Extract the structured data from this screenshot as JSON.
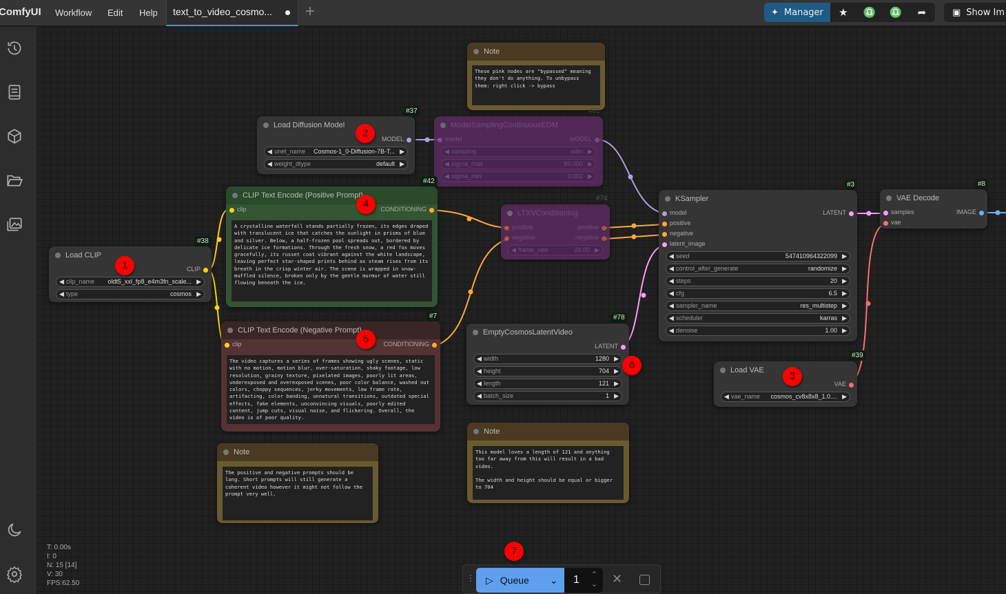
{
  "app": {
    "brand": "ComfyUI",
    "menu": [
      "Workflow",
      "Edit",
      "Help"
    ],
    "tab_title": "text_to_video_cosmo...",
    "manager_label": "Manager",
    "show_image_label": "Show Im"
  },
  "sidebar": [
    "history-icon",
    "book-icon",
    "cube-icon",
    "folder-open-icon",
    "images-icon",
    "moon-icon",
    "gear-icon"
  ],
  "stats": {
    "t": "T: 0.00s",
    "i": "I: 0",
    "n": "N: 15 [14]",
    "v": "V: 30",
    "fps": "FPS:62.50"
  },
  "queue": {
    "label": "Queue",
    "count": "1"
  },
  "nodes": {
    "note_top": {
      "title": "Note",
      "text": "These pink nodes are \"bypassed\" meaning\nthey don't do anything. To unbypass\nthem: right click -> bypass"
    },
    "load_diffusion": {
      "id": "#37",
      "title": "Load Diffusion Model",
      "output": "MODEL",
      "widgets": [
        {
          "name": "unet_name",
          "value": "Cosmos-1_0-Diffusion-7B-T..."
        },
        {
          "name": "weight_dtype",
          "value": "default"
        }
      ]
    },
    "model_sampling": {
      "id": "#61",
      "title": "ModelSamplingContinuousEDM",
      "input": "model",
      "output": "MODEL",
      "widgets": [
        {
          "name": "sampling",
          "value": "edm"
        },
        {
          "name": "sigma_max",
          "value": "80.000"
        },
        {
          "name": "sigma_min",
          "value": "0.002"
        }
      ]
    },
    "clip_pos": {
      "id": "#42",
      "title": "CLIP Text Encode (Positive Prompt)",
      "input": "clip",
      "output": "CONDITIONING",
      "text": "A crystalline waterfall stands partially frozen, its edges draped with translucent ice that catches the sunlight in prisms of blue and silver. Below, a half-frozen pool spreads out, bordered by delicate ice formations. Through the fresh snow, a red fox moves gracefully, its russet coat vibrant against the white landscape, leaving perfect star-shaped prints behind as steam rises from its breath in the crisp winter air. The scene is wrapped in snow-muffled silence, broken only by the gentle murmur of water still flowing beneath the ice."
    },
    "clip_neg": {
      "id": "#7",
      "title": "CLIP Text Encode (Negative Prompt)",
      "input": "clip",
      "output": "CONDITIONING",
      "text": "The video captures a series of frames showing ugly scenes, static with no motion, motion blur, over-saturation, shaky footage, low resolution, grainy texture, pixelated images, poorly lit areas, underexposed and overexposed scenes, poor color balance, washed out colors, choppy sequences, jerky movements, low frame rate, artifacting, color banding, unnatural transitions, outdated special effects, fake elements, unconvincing visuals, poorly edited content, jump cuts, visual noise, and flickering. Overall, the video is of poor quality."
    },
    "load_clip": {
      "id": "#38",
      "title": "Load CLIP",
      "output": "CLIP",
      "widgets": [
        {
          "name": "clip_name",
          "value": "oldt5_xxl_fp8_e4m3fn_scale..."
        },
        {
          "name": "type",
          "value": "cosmos"
        }
      ]
    },
    "ltxv": {
      "id": "#74",
      "title": "LTXVConditioning",
      "inputs": [
        "positive",
        "negative"
      ],
      "outputs": [
        "positive",
        "negative"
      ],
      "widgets": [
        {
          "name": "frame_rate",
          "value": "24.00"
        }
      ]
    },
    "ksampler": {
      "id": "#3",
      "title": "KSampler",
      "inputs": [
        "model",
        "positive",
        "negative",
        "latent_image"
      ],
      "output": "LATENT",
      "widgets": [
        {
          "name": "seed",
          "value": "547410964322099"
        },
        {
          "name": "control_after_generate",
          "value": "randomize"
        },
        {
          "name": "steps",
          "value": "20"
        },
        {
          "name": "cfg",
          "value": "6.5"
        },
        {
          "name": "sampler_name",
          "value": "res_multistep"
        },
        {
          "name": "scheduler",
          "value": "karras"
        },
        {
          "name": "denoise",
          "value": "1.00"
        }
      ]
    },
    "vae_decode": {
      "id": "#8",
      "title": "VAE Decode",
      "inputs": [
        "samples",
        "vae"
      ],
      "output": "IMAGE"
    },
    "empty_latent": {
      "id": "#78",
      "title": "EmptyCosmosLatentVideo",
      "output": "LATENT",
      "widgets": [
        {
          "name": "width",
          "value": "1280"
        },
        {
          "name": "height",
          "value": "704"
        },
        {
          "name": "length",
          "value": "121"
        },
        {
          "name": "batch_size",
          "value": "1"
        }
      ]
    },
    "load_vae": {
      "id": "#39",
      "title": "Load VAE",
      "output": "VAE",
      "widgets": [
        {
          "name": "vae_name",
          "value": "cosmos_cv8x8x8_1.0...."
        }
      ]
    },
    "note_mid": {
      "title": "Note",
      "text": "This model loves a length of 121 and anything\ntoo far away from this will result in a bad\nvideo.\n\nThe width and height should be equal or bigger\nto 704"
    },
    "note_left": {
      "title": "Note",
      "text": "The positive and negative prompts should be\nlong. Short prompts will still generate a\ncoherent video however it might not follow the\nprompt very well."
    }
  },
  "badges": [
    "1",
    "2",
    "3",
    "4",
    "5",
    "6",
    "7"
  ],
  "colors": {
    "accent": "#5fa0ee",
    "manager": "#1e5b86",
    "badge": "#ff0000",
    "wire_clip": "#ffd500",
    "wire_cond": "#ffa931",
    "wire_model": "#b39ddb",
    "wire_latent": "#ff9cf9",
    "wire_vae": "#ff6e6e",
    "wire_image": "#64b5f6"
  }
}
